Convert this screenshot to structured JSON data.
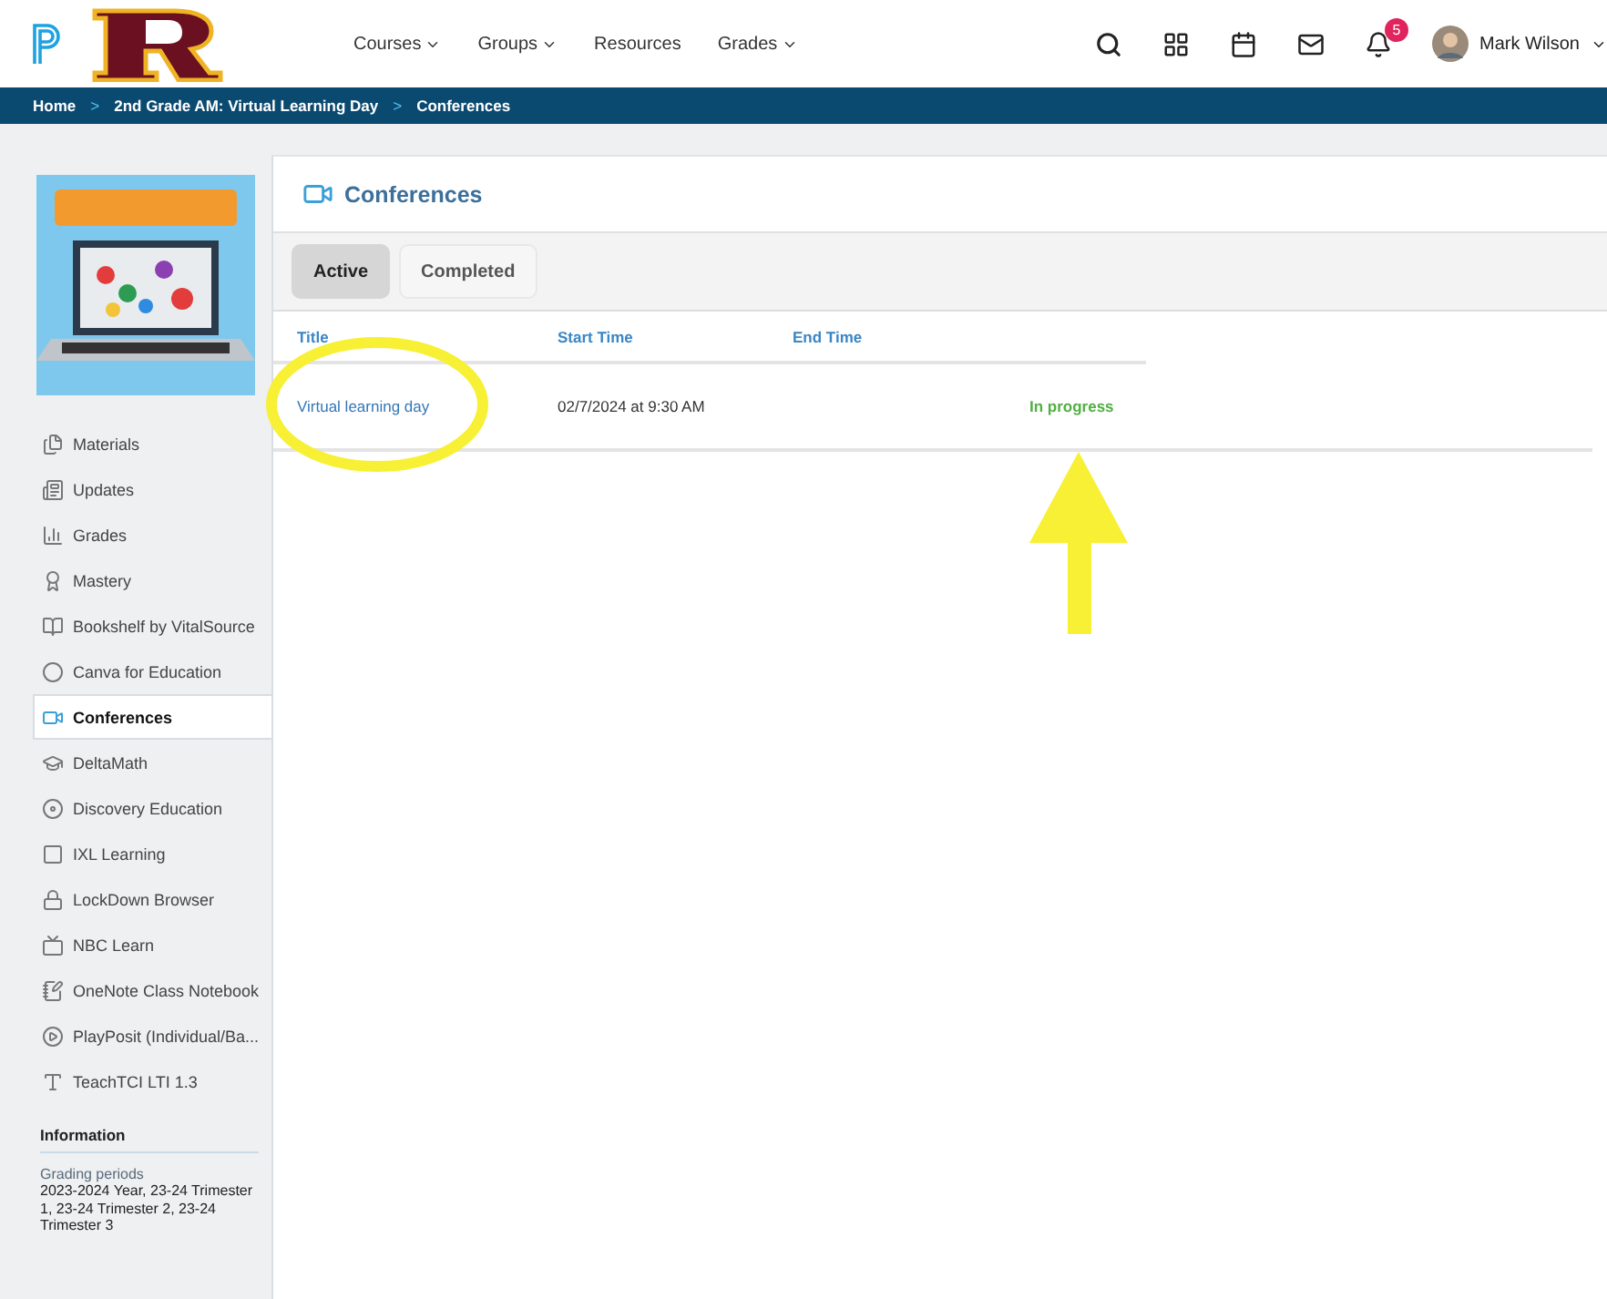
{
  "header": {
    "nav": [
      {
        "label": "Courses",
        "dropdown": true
      },
      {
        "label": "Groups",
        "dropdown": true
      },
      {
        "label": "Resources",
        "dropdown": false
      },
      {
        "label": "Grades",
        "dropdown": true
      }
    ],
    "notification_count": "5",
    "user": {
      "name": "Mark Wilson",
      "dropdown": true
    }
  },
  "breadcrumb": {
    "separator": ">",
    "items": [
      "Home",
      "2nd Grade AM: Virtual Learning Day",
      "Conferences"
    ]
  },
  "sidebar": {
    "items": [
      {
        "label": "Materials",
        "selected": false
      },
      {
        "label": "Updates",
        "selected": false
      },
      {
        "label": "Grades",
        "selected": false
      },
      {
        "label": "Mastery",
        "selected": false
      },
      {
        "label": "Bookshelf by VitalSource",
        "selected": false
      },
      {
        "label": "Canva for Education",
        "selected": false
      },
      {
        "label": "Conferences",
        "selected": true
      },
      {
        "label": "DeltaMath",
        "selected": false
      },
      {
        "label": "Discovery Education",
        "selected": false
      },
      {
        "label": "IXL Learning",
        "selected": false
      },
      {
        "label": "LockDown Browser",
        "selected": false
      },
      {
        "label": "NBC Learn",
        "selected": false
      },
      {
        "label": "OneNote Class Notebook",
        "selected": false
      },
      {
        "label": "PlayPosit (Individual/Ba...",
        "selected": false
      },
      {
        "label": "TeachTCI LTI 1.3",
        "selected": false
      }
    ],
    "information": {
      "heading": "Information",
      "label": "Grading periods",
      "value": "2023-2024 Year, 23-24 Trimester 1, 23-24 Trimester 2, 23-24 Trimester 3"
    }
  },
  "main": {
    "title": "Conferences",
    "tabs": [
      {
        "label": "Active",
        "selected": true
      },
      {
        "label": "Completed",
        "selected": false
      }
    ],
    "table": {
      "columns": [
        "Title",
        "Start Time",
        "End Time"
      ],
      "rows": [
        {
          "title": "Virtual learning day",
          "start_time": "02/7/2024 at 9:30 AM",
          "status": "In progress"
        }
      ]
    }
  },
  "annotations": [
    {
      "kind": "ellipse"
    },
    {
      "kind": "arrow"
    }
  ]
}
